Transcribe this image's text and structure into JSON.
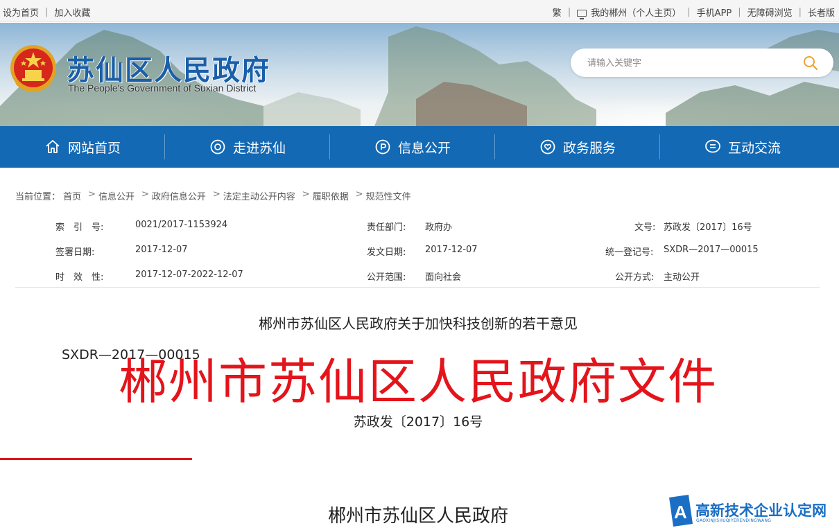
{
  "topbar": {
    "left": [
      "设为首页",
      "加入收藏"
    ],
    "right": [
      "繁",
      "我的郴州（个人主页）",
      "手机APP",
      "无障碍浏览",
      "长者版"
    ]
  },
  "header": {
    "title": "苏仙区人民政府",
    "subtitle": "The People's Government of Suxian District",
    "search_placeholder": "请输入关键字"
  },
  "nav": [
    {
      "label": "网站首页",
      "icon": "home-icon"
    },
    {
      "label": "走进苏仙",
      "icon": "target-icon"
    },
    {
      "label": "信息公开",
      "icon": "info-icon"
    },
    {
      "label": "政务服务",
      "icon": "heart-icon"
    },
    {
      "label": "互动交流",
      "icon": "chat-icon"
    }
  ],
  "breadcrumb": {
    "label": "当前位置：",
    "items": [
      "首页",
      "信息公开",
      "政府信息公开",
      "法定主动公开内容",
      "履职依据",
      "规范性文件"
    ]
  },
  "meta": {
    "index_label": "索　引　号:",
    "index_value": "0021/2017-1153924",
    "dept_label": "责任部门:",
    "dept_value": "政府办",
    "docno_label": "文号:",
    "docno_value": "苏政发〔2017〕16号",
    "sign_label": "签署日期:",
    "sign_value": "2017-12-07",
    "issue_label": "发文日期:",
    "issue_value": "2017-12-07",
    "reg_label": "统一登记号:",
    "reg_value": "SXDR—2017—00015",
    "valid_label": "时　效　性:",
    "valid_value": "2017-12-07-2022-12-07",
    "scope_label": "公开范围:",
    "scope_value": "面向社会",
    "mode_label": "公开方式:",
    "mode_value": "主动公开"
  },
  "document": {
    "title": "郴州市苏仙区人民政府关于加快科技创新的若干意见",
    "code": "SXDR—2017—00015",
    "red_header": "郴州市苏仙区人民政府文件",
    "number": "苏政发〔2017〕16号",
    "issuer": "郴州市苏仙区人民政府"
  },
  "watermark": {
    "text": "高新技术企业认定网",
    "sub": "GAOXINJISHUQIYERENDINGWANG"
  },
  "colors": {
    "nav_bg": "#1369b4",
    "title_blue": "#1a5fa8",
    "red": "#e4141b"
  }
}
